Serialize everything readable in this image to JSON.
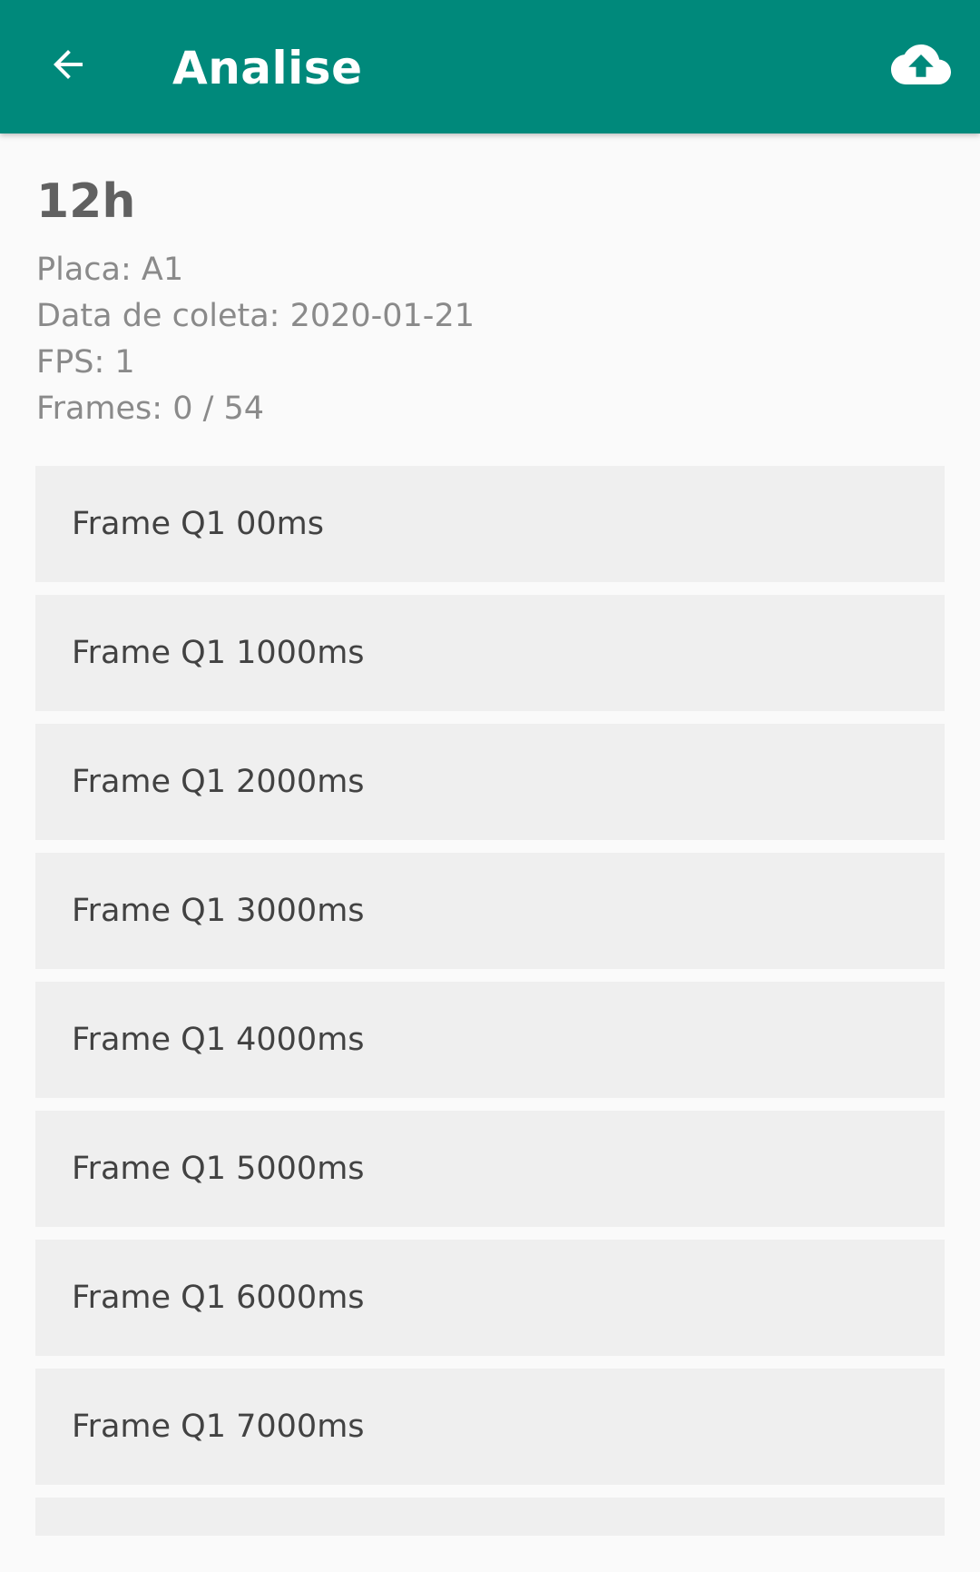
{
  "appbar": {
    "title": "Analise",
    "back_icon": "arrow-left-icon",
    "upload_icon": "cloud-upload-icon",
    "color": "#00897b"
  },
  "header": {
    "title": "12h",
    "placa": "Placa: A1",
    "data_coleta": "Data de coleta: 2020-01-21",
    "fps": "FPS: 1",
    "frames": "Frames: 0 / 54"
  },
  "frames": [
    {
      "label": "Frame Q1 00ms"
    },
    {
      "label": "Frame Q1 1000ms"
    },
    {
      "label": "Frame Q1 2000ms"
    },
    {
      "label": "Frame Q1 3000ms"
    },
    {
      "label": "Frame Q1 4000ms"
    },
    {
      "label": "Frame Q1 5000ms"
    },
    {
      "label": "Frame Q1 6000ms"
    },
    {
      "label": "Frame Q1 7000ms"
    }
  ]
}
